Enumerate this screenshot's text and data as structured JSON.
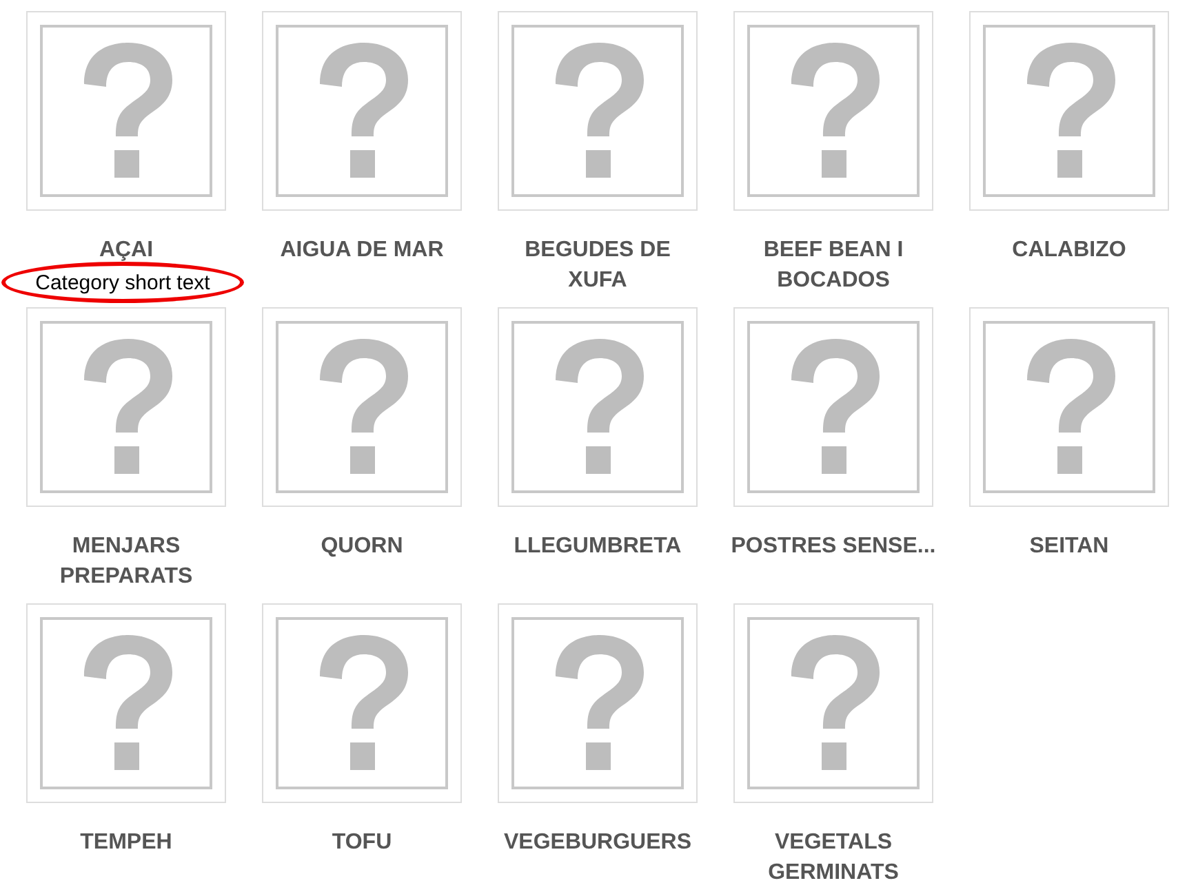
{
  "categories": [
    {
      "label": "AÇAI",
      "image": {
        "kind": "picture-placeholder"
      }
    },
    {
      "label": "AIGUA DE MAR",
      "image": {
        "kind": "picture-placeholder"
      }
    },
    {
      "label": "BEGUDES DE XUFA",
      "image": {
        "kind": "picture-placeholder"
      }
    },
    {
      "label": "BEEF BEAN I BOCADOS",
      "image": {
        "kind": "picture-placeholder"
      }
    },
    {
      "label": "CALABIZO",
      "image": {
        "kind": "picture-placeholder"
      }
    },
    {
      "label": "MENJARS PREPARATS",
      "image": {
        "kind": "picture-placeholder"
      }
    },
    {
      "label": "QUORN",
      "image": {
        "kind": "picture-placeholder"
      }
    },
    {
      "label": "LLEGUMBRETA",
      "image": {
        "kind": "picture-placeholder"
      }
    },
    {
      "label": "POSTRES SENSE...",
      "image": {
        "kind": "picture-placeholder"
      }
    },
    {
      "label": "SEITAN",
      "image": {
        "kind": "picture-placeholder"
      }
    },
    {
      "label": "TEMPEH",
      "image": {
        "kind": "picture-placeholder"
      }
    },
    {
      "label": "TOFU",
      "image": {
        "kind": "picture-placeholder"
      }
    },
    {
      "label": "VEGEBURGUERS",
      "image": {
        "kind": "picture-placeholder"
      }
    },
    {
      "label": "VEGETALS GERMINATS",
      "image": {
        "kind": "picture-placeholder"
      }
    }
  ],
  "annotation": {
    "text": "Category short text"
  }
}
